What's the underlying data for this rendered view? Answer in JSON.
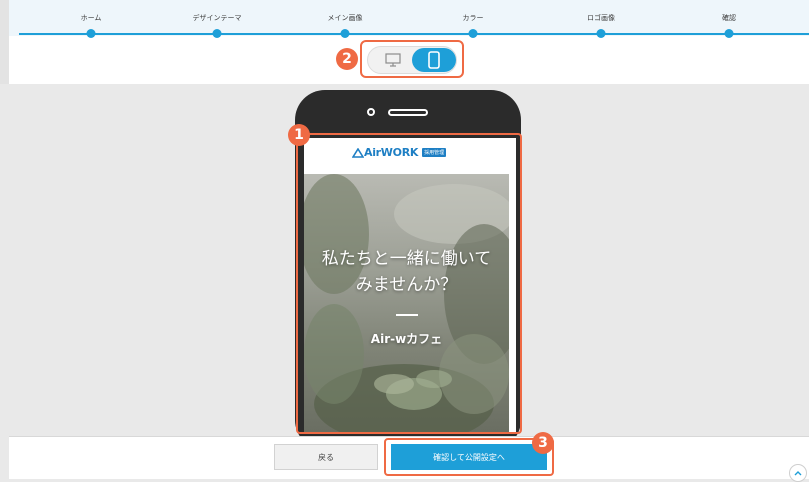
{
  "steps": [
    "ホーム",
    "デザインテーマ",
    "メイン画像",
    "カラー",
    "ロゴ画像",
    "確認"
  ],
  "view_toggle": {
    "desktop_icon": "desktop-icon",
    "mobile_icon": "smartphone-icon",
    "selected": "mobile"
  },
  "badges": {
    "b1": "1",
    "b2": "2",
    "b3": "3"
  },
  "preview": {
    "logo_text": "AirWORK",
    "logo_tag": "採用管理",
    "hero_line1": "私たちと一緒に働いて",
    "hero_line2": "みませんか？",
    "hero_name": "Air-wカフェ"
  },
  "footer": {
    "back_label": "戻る",
    "confirm_label": "確認して公開設定へ"
  },
  "colors": {
    "accent": "#1e9fd8",
    "annotation": "#ef6a44",
    "brand": "#1e7fc4"
  }
}
